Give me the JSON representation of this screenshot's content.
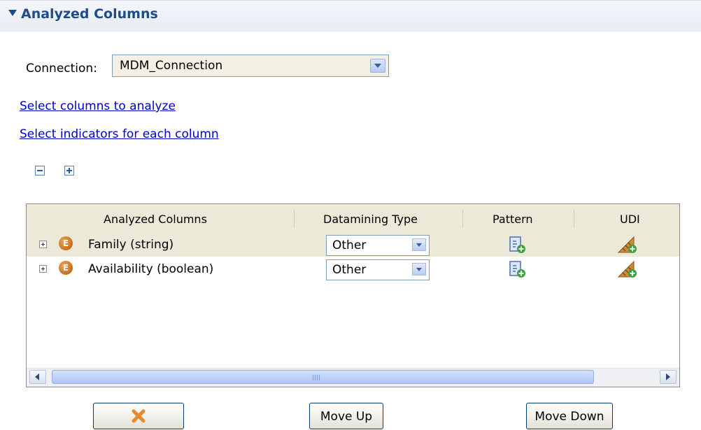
{
  "section": {
    "title": "Analyzed Columns"
  },
  "connection": {
    "label": "Connection:",
    "value": "MDM_Connection"
  },
  "links": {
    "select_columns": "Select columns to analyze",
    "select_indicators": "Select indicators for each column"
  },
  "table": {
    "headers": [
      "Analyzed Columns",
      "Datamining Type",
      "Pattern",
      "UDI"
    ],
    "rows": [
      {
        "icon": "E",
        "name": "Family (string)",
        "datamining_type": "Other"
      },
      {
        "icon": "E",
        "name": "Availability (boolean)",
        "datamining_type": "Other"
      }
    ],
    "scroll_grip": "III"
  },
  "buttons": {
    "move_up": "Move Up",
    "move_down": "Move Down"
  },
  "colors": {
    "header_text": "#1f4b8b",
    "link": "#0000cc",
    "row_selected": "#ece9d8",
    "delete_icon": "#e88a2e"
  },
  "icons": {
    "collapse_all": "collapse-all-icon",
    "expand_all": "expand-all-icon",
    "pattern": "add-pattern-icon",
    "udi": "add-udi-icon",
    "delete": "delete-x-icon"
  }
}
